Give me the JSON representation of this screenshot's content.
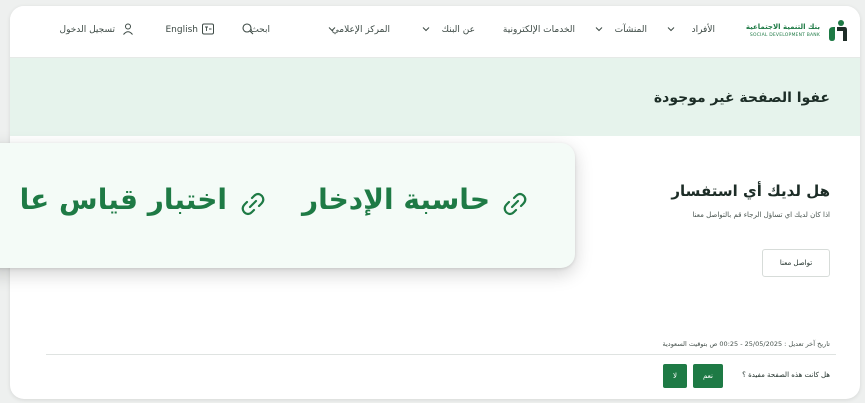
{
  "nav": {
    "logo_line1": "بنك التنمية الاجتماعية",
    "logo_line2": "SOCIAL DEVELOPMENT BANK",
    "items": [
      {
        "label": "الأفراد"
      },
      {
        "label": "المنشآت"
      },
      {
        "label": "الخدمات الإلكترونية"
      },
      {
        "label": "عن البنك"
      },
      {
        "label": "المركز الإعلامي"
      }
    ],
    "search_label": "ابحث",
    "language_label": "English",
    "login_label": "تسجيل الدخول"
  },
  "banner": {
    "title": "عفوا الصفحة غير موجودة"
  },
  "inquiry": {
    "title": "هل لديك أي استفسار",
    "description": "اذا كان لديك اي تساؤل الرجاء قم بالتواصل معنا",
    "contact_button": "تواصل معنا"
  },
  "footer": {
    "last_modified": "تاريخ آخر تعديل : 25/05/2025 - 00:25 ص بتوقيت السعودية",
    "helpful_question": "هل كانت هذه الصفحة مفيدة ؟",
    "yes_label": "نعم",
    "no_label": "لا"
  },
  "overlay": {
    "item1": "حاسبة الإدخار",
    "item2": "اختبار قياس عا"
  },
  "colors": {
    "brand_green": "#1e7a45",
    "banner_bg": "#e6f3ec",
    "overlay_bg": "#f4fbf7"
  }
}
